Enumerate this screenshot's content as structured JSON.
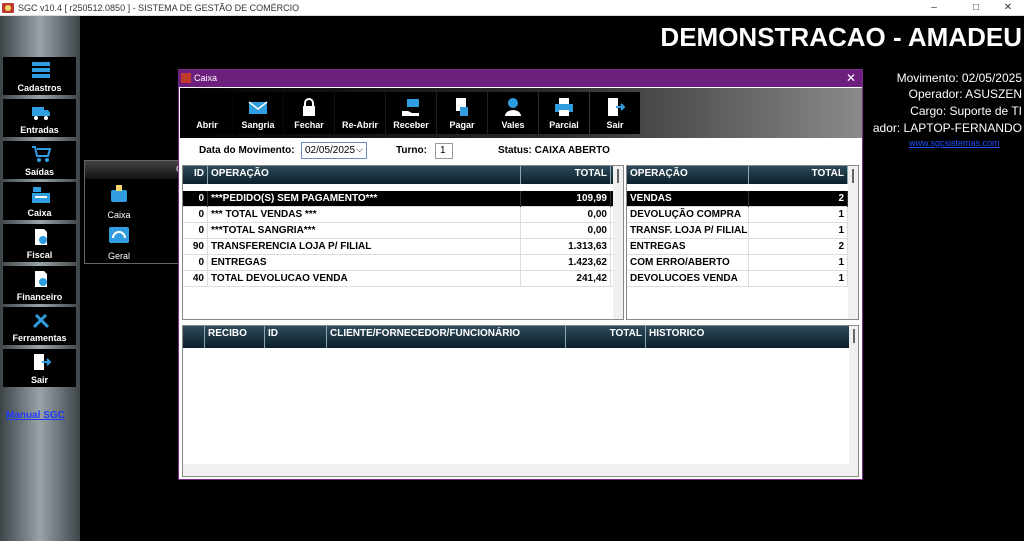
{
  "app": {
    "title": "SGC v10.4 [ r250512.0850 ] - SISTEMA DE GESTÃO DE COMÉRCIO",
    "controls": {
      "minimize": "–",
      "maximize": "□",
      "close": "✕"
    }
  },
  "sidebar": {
    "items": [
      {
        "label": "Cadastros",
        "icon": "stack-icon"
      },
      {
        "label": "Entradas",
        "icon": "truck-icon"
      },
      {
        "label": "Saídas",
        "icon": "cart-icon"
      },
      {
        "label": "Caixa",
        "icon": "cash-register-icon"
      },
      {
        "label": "Fiscal",
        "icon": "fiscal-doc-icon"
      },
      {
        "label": "Financeiro",
        "icon": "finance-doc-icon"
      },
      {
        "label": "Ferramentas",
        "icon": "tools-icon"
      },
      {
        "label": "Sair",
        "icon": "exit-door-icon"
      }
    ],
    "manual_link": "Manual SGC"
  },
  "header": {
    "company": "DEMONSTRACAO - AMADEU",
    "movimento": "Movimento: 02/05/2025",
    "operador": "Operador: ASUSZEN",
    "cargo": "Cargo: Suporte de TI",
    "computador": "ador: LAPTOP-FERNANDO",
    "site": "www.sgcsistemas.com"
  },
  "subpanel": {
    "header_char": "C",
    "items": [
      {
        "label": "Caixa",
        "icon": "cash-icon"
      },
      {
        "label": "Geral",
        "icon": "dashboard-icon"
      }
    ]
  },
  "caixa_window": {
    "title": "Caixa",
    "close": "✕",
    "toolbar": [
      {
        "label": "Abrir",
        "icon": "open-icon"
      },
      {
        "label": "Sangria",
        "icon": "envelope-icon"
      },
      {
        "label": "Fechar",
        "icon": "lock-icon"
      },
      {
        "label": "Re-Abrir",
        "icon": "reopen-icon"
      },
      {
        "label": "Receber",
        "icon": "receive-money-icon"
      },
      {
        "label": "Pagar",
        "icon": "pay-icon"
      },
      {
        "label": "Vales",
        "icon": "user-voucher-icon"
      },
      {
        "label": "Parcial",
        "icon": "printer-icon"
      },
      {
        "label": "Sair",
        "icon": "exit-door-icon"
      }
    ],
    "form": {
      "date_label": "Data do Movimento:",
      "date_value": "02/05/2025",
      "turno_label": "Turno:",
      "turno_value": "1",
      "status": "Status: CAIXA ABERTO"
    },
    "left_grid": {
      "headers": [
        "ID",
        "OPERAÇÃO",
        "TOTAL"
      ],
      "rows": [
        {
          "id": "0",
          "op": "***PEDIDO(S) SEM PAGAMENTO***",
          "total": "109,99",
          "selected": true
        },
        {
          "id": "0",
          "op": "*** TOTAL VENDAS ***",
          "total": "0,00",
          "selected": false
        },
        {
          "id": "0",
          "op": "***TOTAL SANGRIA***",
          "total": "0,00",
          "selected": false
        },
        {
          "id": "90",
          "op": "TRANSFERENCIA LOJA P/ FILIAL",
          "total": "1.313,63",
          "selected": false
        },
        {
          "id": "0",
          "op": "ENTREGAS",
          "total": "1.423,62",
          "selected": false
        },
        {
          "id": "40",
          "op": "TOTAL DEVOLUCAO VENDA",
          "total": "241,42",
          "selected": false
        }
      ]
    },
    "right_grid": {
      "headers": [
        "OPERAÇÃO",
        "TOTAL"
      ],
      "rows": [
        {
          "op": "VENDAS",
          "total": "2",
          "selected": true
        },
        {
          "op": "DEVOLUÇÃO COMPRA",
          "total": "1",
          "selected": false
        },
        {
          "op": "TRANSF. LOJA P/ FILIAL",
          "total": "1",
          "selected": false
        },
        {
          "op": "ENTREGAS",
          "total": "2",
          "selected": false
        },
        {
          "op": "COM ERRO/ABERTO",
          "total": "1",
          "selected": false
        },
        {
          "op": "DEVOLUCOES VENDA",
          "total": "1",
          "selected": false
        }
      ]
    },
    "bottom_grid": {
      "headers": [
        "RECIBO",
        "ID",
        "CLIENTE/FORNECEDOR/FUNCIONÁRIO",
        "TOTAL",
        "HISTORICO"
      ]
    }
  }
}
